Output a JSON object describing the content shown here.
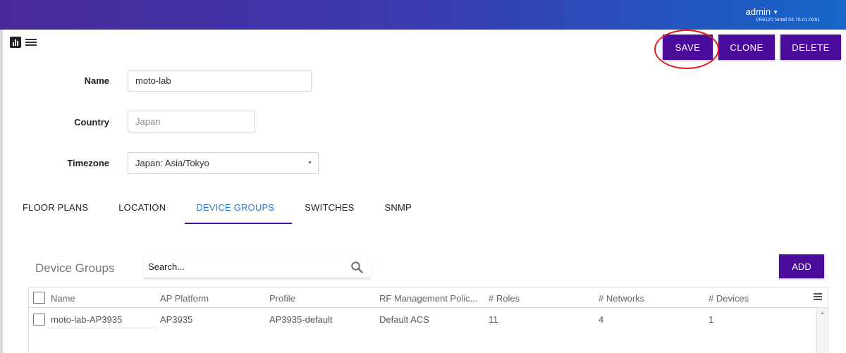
{
  "topbar": {
    "user": "admin",
    "version": "VE6120 Small 04.76.01.0081"
  },
  "toolbar": {
    "save": "SAVE",
    "clone": "CLONE",
    "delete": "DELETE"
  },
  "form": {
    "name_label": "Name",
    "name_value": "moto-lab",
    "country_label": "Country",
    "country_placeholder": "Japan",
    "timezone_label": "Timezone",
    "timezone_value": "Japan: Asia/Tokyo"
  },
  "tabs": [
    {
      "label": "FLOOR PLANS"
    },
    {
      "label": "LOCATION"
    },
    {
      "label": "DEVICE GROUPS",
      "active": true
    },
    {
      "label": "SWITCHES"
    },
    {
      "label": "SNMP"
    }
  ],
  "device_groups": {
    "title": "Device Groups",
    "search_placeholder": "Search...",
    "add": "ADD",
    "columns": [
      "Name",
      "AP Platform",
      "Profile",
      "RF Management Polic...",
      "# Roles",
      "# Networks",
      "# Devices"
    ],
    "rows": [
      [
        "moto-lab-AP3935",
        "AP3935",
        "AP3935-default",
        "Default ACS",
        "11",
        "4",
        "1"
      ]
    ]
  },
  "colors": {
    "accent": "#4b0c9c",
    "active_tab": "#2e7bd6",
    "annotation": "#e21818"
  },
  "icons": {
    "view_chart": "bar-chart-icon",
    "view_list": "list-icon",
    "search": "search-icon",
    "columns_menu": "hamburger-menu-icon"
  }
}
